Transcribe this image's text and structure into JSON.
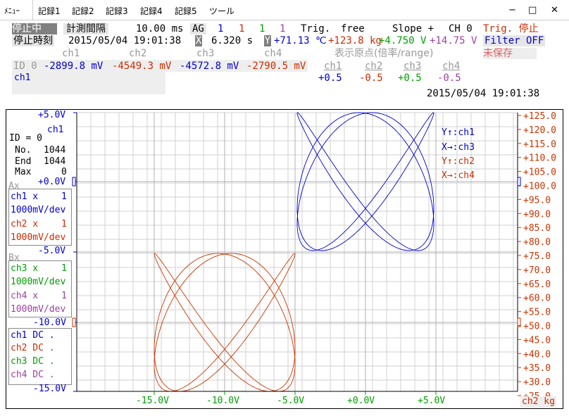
{
  "menu": {
    "items": [
      "ﾒﾆｭｰ",
      "記録1",
      "記録2",
      "記録3",
      "記録4",
      "記録5",
      "ツール"
    ],
    "min_icon": "−",
    "restore_icon": "□",
    "close_icon": "✕"
  },
  "status": {
    "state": "停止中",
    "interval_label": "計測間隔",
    "interval_value": "10.00 ms",
    "ag_label": "AG",
    "ag_values": [
      "1",
      "1",
      "1",
      "1"
    ],
    "trig_label": "Trig.",
    "trig_value": "free",
    "slope_label": "Slope +",
    "ch_label": "CH 0",
    "trig_stop": "Trig. 停止",
    "stop_time_label": "停止時刻",
    "stop_time_value": "2015/05/04 19:01:38",
    "x_marker": "X",
    "x_value": "6.320 s",
    "y_marker": "Y",
    "readings": [
      "+71.13 ℃",
      "+123.8 kg",
      "+4.750 V",
      "+14.75 V"
    ],
    "filter": "Filter OFF",
    "unsaved": "未保存"
  },
  "channels": {
    "headers": [
      "ch1",
      "ch2",
      "ch3",
      "ch4"
    ],
    "id_label": "ID 0",
    "values": [
      "-2899.8 mV",
      "-4549.3 mV",
      "-4572.8 mV",
      "-2790.5 mV"
    ],
    "origin_title": "表示原点(倍率/range)",
    "origin_headers": [
      "ch1",
      "ch2",
      "ch3",
      "ch4"
    ],
    "origin_values": [
      "+0.5",
      "-0.5",
      "+0.5",
      "-0.5"
    ],
    "ch1_name": "ch1",
    "timestamp": "2015/05/04 19:01:38"
  },
  "plot": {
    "left_axis_top": "+5.0V",
    "left_axis_mid": "+0.0V",
    "left_axis_neg5": "-5.0V",
    "left_axis_neg10": "-10.0V",
    "left_axis_neg15": "-15.0V",
    "ch_label": "ch1",
    "id_line": "ID = 0",
    "no_label": "No.",
    "no_value": "1044",
    "end_label": "End",
    "end_value": "1044",
    "max_label": "Max",
    "max_value": "0",
    "ax_label": "Ax",
    "bx_label": "Bx",
    "ax_rows": [
      {
        "name": "ch1 x",
        "mult": "1",
        "scale": "1000mV/dev"
      },
      {
        "name": "ch2 x",
        "mult": "1",
        "scale": "1000mV/dev"
      }
    ],
    "bx_rows": [
      {
        "name": "ch3 x",
        "mult": "1",
        "scale": "1000mV/dev"
      },
      {
        "name": "ch4 x",
        "mult": "1",
        "scale": "1000mV/dev"
      }
    ],
    "dc_rows": [
      "ch1 DC  .",
      "ch2 DC  .",
      "ch3 DC  .",
      "ch4 DC  ."
    ],
    "x_ticks": [
      "-15.0V",
      "-10.0V",
      "-5.0V",
      "+0.0V",
      "+5.0V"
    ],
    "right_ticks": [
      "+125.0",
      "+120.0",
      "+115.0",
      "+110.0",
      "+105.0",
      "+100.0",
      "+95.0",
      "+90.0",
      "+85.0",
      "+80.0",
      "+75.0",
      "+70.0",
      "+65.0",
      "+60.0",
      "+55.0",
      "+50.0",
      "+45.0",
      "+40.0",
      "+35.0",
      "+30.0",
      "+25.0"
    ],
    "right_unit": "ch2  kg",
    "legend": [
      "Y↑:ch1",
      "X→:ch3",
      "Y↑:ch2",
      "X→:ch4"
    ],
    "colors": {
      "ch1": "#0000cc",
      "ch2": "#cc3300",
      "ch3": "#00a000",
      "ch4": "#a040a0"
    }
  }
}
